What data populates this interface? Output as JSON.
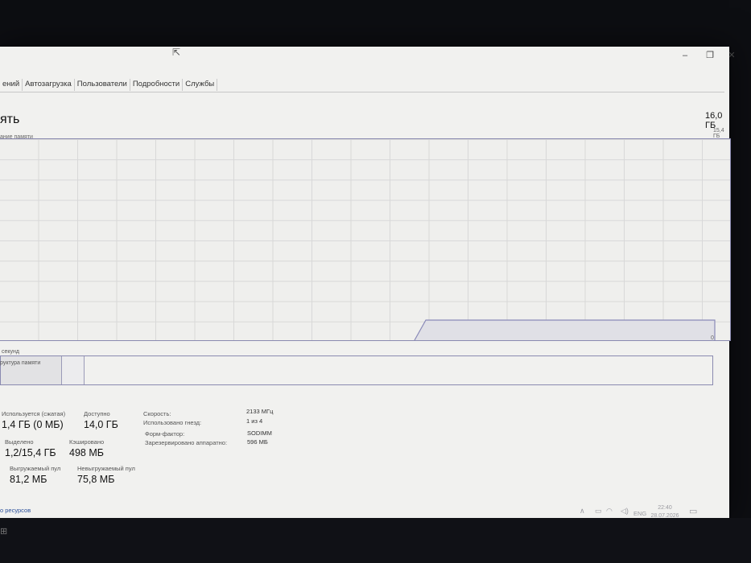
{
  "tabs": [
    "ений",
    "Автозагрузка",
    "Пользователи",
    "Подробности",
    "Службы"
  ],
  "window_controls": {
    "minimize": "–",
    "maximize": "❐",
    "close": "✕"
  },
  "header": {
    "title": "ять",
    "total": "16,0 ГБ",
    "graph_caption": "ание памяти",
    "graph_max": "15,4 ГБ",
    "graph_zero": "0",
    "graph_seconds": "секунд"
  },
  "memory_graph": {
    "usage_fraction": 0.1
  },
  "structure": {
    "label": "руктура памяти",
    "in_use_fraction": 0.085,
    "modified_fraction": 0.03
  },
  "stats": {
    "in_use_label": "Используется (сжатая)",
    "in_use_value": "1,4 ГБ (0 МБ)",
    "available_label": "Доступно",
    "available_value": "14,0 ГБ",
    "committed_label": "Выделено",
    "committed_value": "1,2/15,4 ГБ",
    "cached_label": "Кэшировано",
    "cached_value": "498 МБ",
    "paged_label": "Выгружаемый пул",
    "paged_value": "81,2 МБ",
    "nonpaged_label": "Невыгружаемый пул",
    "nonpaged_value": "75,8 МБ"
  },
  "specs": {
    "speed_label": "Скорость:",
    "speed_value": "2133 МГц",
    "slots_label": "Использовано гнезд:",
    "slots_value": "1 из 4",
    "form_label": "Форм-фактор:",
    "form_value": "SODIMM",
    "reserved_label": "Зарезервировано аппаратно:",
    "reserved_value": "596 МБ"
  },
  "footer": {
    "monitor_link": "о ресурсов"
  },
  "taskbar": {
    "chevron": "∧",
    "battery": "▭",
    "wifi": "◠",
    "volume": "◁)",
    "lang": "ENG",
    "time": "22:40",
    "date": "28.07.2026",
    "notifications": "▭",
    "start": "⊞"
  }
}
